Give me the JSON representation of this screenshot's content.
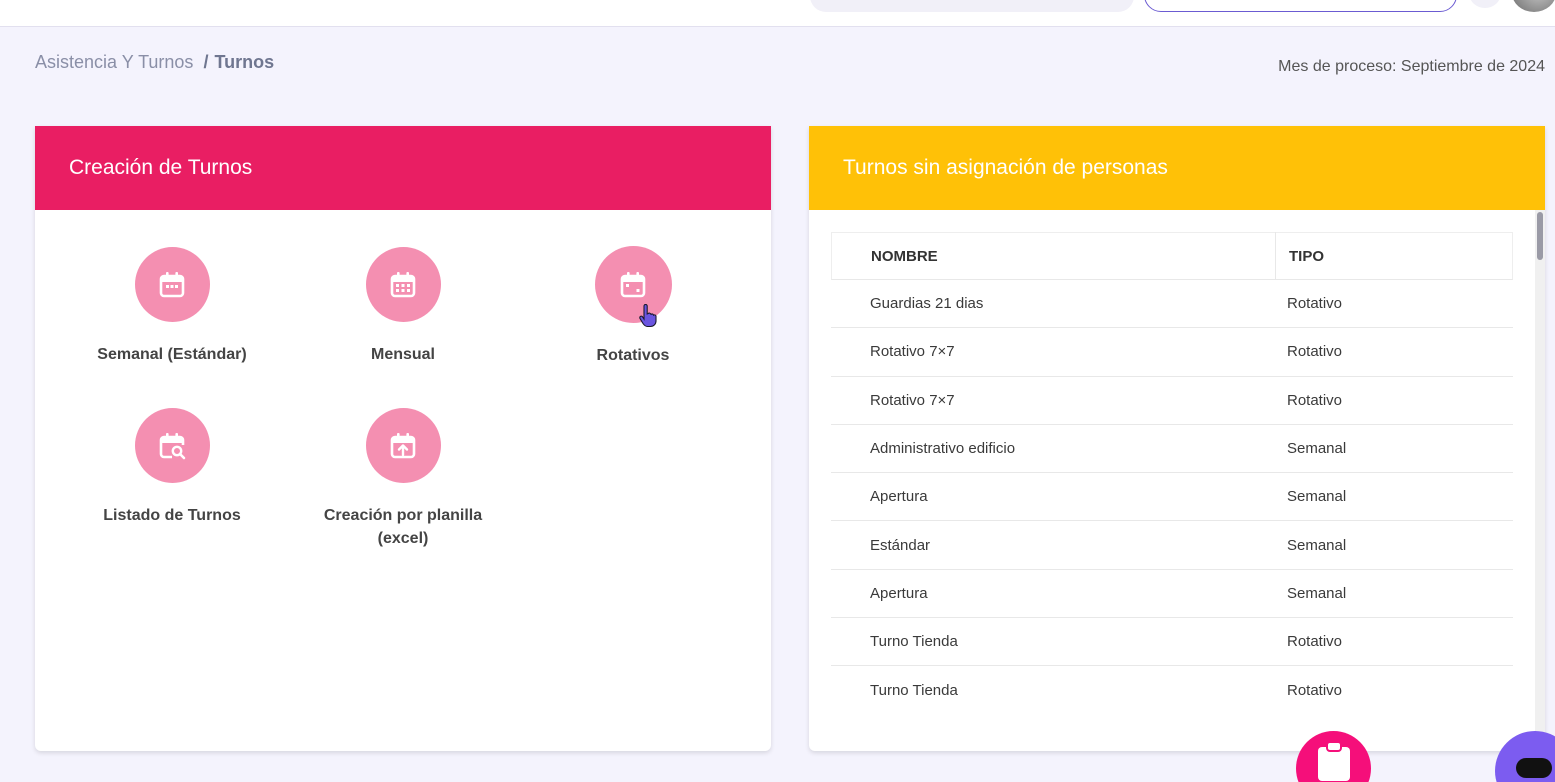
{
  "breadcrumb": {
    "parent": "Asistencia Y Turnos",
    "separator": "/",
    "current": "Turnos"
  },
  "process_month": "Mes de proceso: Septiembre de 2024",
  "creation_card": {
    "title": "Creación de Turnos",
    "header_color": "#e91e63",
    "tiles": [
      {
        "label": "Semanal (Estándar)",
        "icon": "calendar-week-icon"
      },
      {
        "label": "Mensual",
        "icon": "calendar-month-icon"
      },
      {
        "label": "Rotativos",
        "icon": "calendar-rotate-icon"
      },
      {
        "label": "Listado de Turnos",
        "icon": "calendar-search-icon"
      },
      {
        "label": "Creación por planilla (excel)",
        "icon": "calendar-upload-icon"
      }
    ]
  },
  "unassigned_card": {
    "title": "Turnos sin asignación de personas",
    "header_color": "#ffc107",
    "columns": [
      "NOMBRE",
      "TIPO"
    ],
    "rows": [
      {
        "name": "Guardias 21 dias",
        "type": "Rotativo"
      },
      {
        "name": "Rotativo 7×7",
        "type": "Rotativo"
      },
      {
        "name": "Rotativo 7×7",
        "type": "Rotativo"
      },
      {
        "name": "Administrativo edificio",
        "type": "Semanal"
      },
      {
        "name": "Apertura",
        "type": "Semanal"
      },
      {
        "name": "Estándar",
        "type": "Semanal"
      },
      {
        "name": "Apertura",
        "type": "Semanal"
      },
      {
        "name": "Turno Tienda",
        "type": "Rotativo"
      },
      {
        "name": "Turno Tienda",
        "type": "Rotativo"
      }
    ]
  }
}
